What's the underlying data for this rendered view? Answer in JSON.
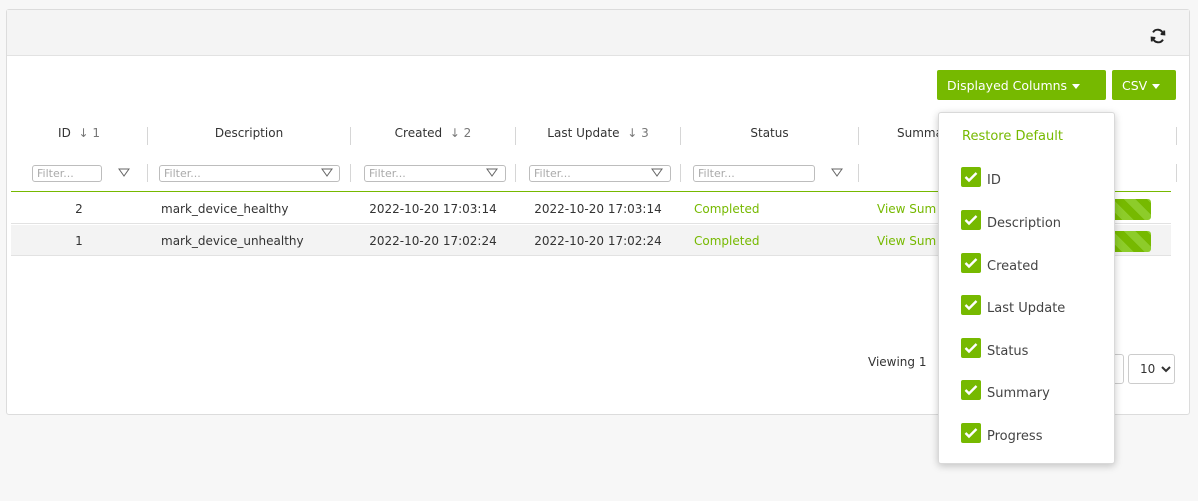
{
  "toolbar": {
    "displayed_columns_label": "Displayed Columns",
    "csv_label": "CSV"
  },
  "table": {
    "columns": [
      {
        "label": "ID",
        "sort": "↓ 1"
      },
      {
        "label": "Description",
        "sort": ""
      },
      {
        "label": "Created",
        "sort": "↓ 2"
      },
      {
        "label": "Last Update",
        "sort": "↓ 3"
      },
      {
        "label": "Status",
        "sort": ""
      },
      {
        "label": "Summa",
        "sort": ""
      }
    ],
    "filter_placeholder": "Filter...",
    "rows": [
      {
        "id": "2",
        "description": "mark_device_healthy",
        "created": "2022-10-20 17:03:14",
        "last_update": "2022-10-20 17:03:14",
        "status": "Completed",
        "summary": "View Sum",
        "progress": 100
      },
      {
        "id": "1",
        "description": "mark_device_unhealthy",
        "created": "2022-10-20 17:02:24",
        "last_update": "2022-10-20 17:02:24",
        "status": "Completed",
        "summary": "View Sum",
        "progress": 100
      }
    ]
  },
  "footer": {
    "viewing_text": "Viewing 1",
    "page_size": "10"
  },
  "dropdown": {
    "restore_label": "Restore Default",
    "items": [
      {
        "label": "ID",
        "checked": true
      },
      {
        "label": "Description",
        "checked": true
      },
      {
        "label": "Created",
        "checked": true
      },
      {
        "label": "Last Update",
        "checked": true
      },
      {
        "label": "Status",
        "checked": true
      },
      {
        "label": "Summary",
        "checked": true
      },
      {
        "label": "Progress",
        "checked": true
      }
    ]
  },
  "colors": {
    "accent": "#76b900",
    "status_completed": "#76b900"
  },
  "icons": [
    "refresh-icon",
    "filter-icon",
    "caret-down-icon",
    "checkmark-icon",
    "chevron-down-icon"
  ]
}
